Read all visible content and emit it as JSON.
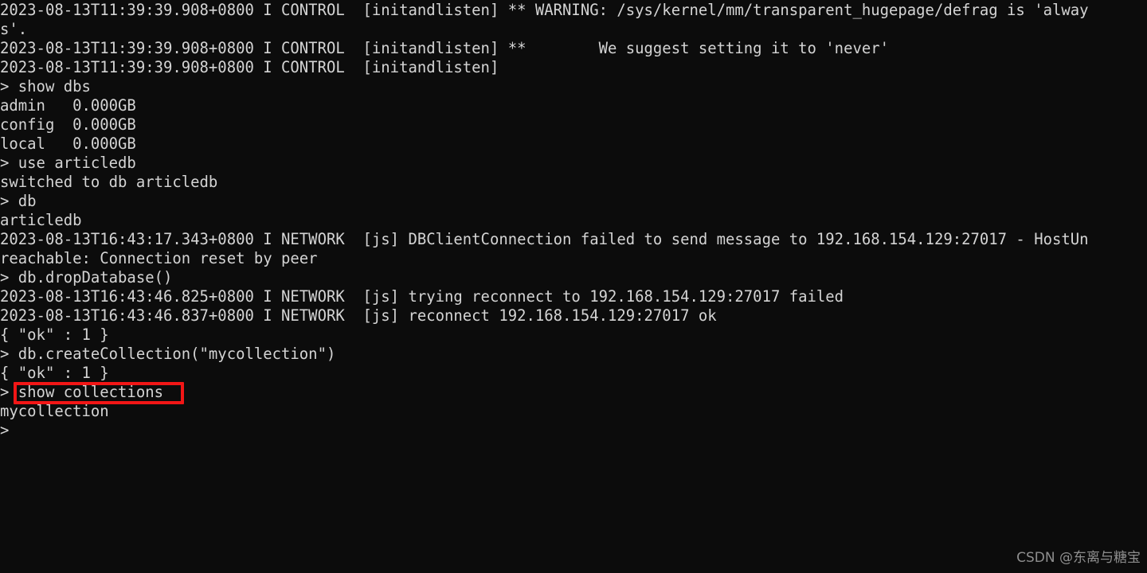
{
  "terminal": {
    "title": "mongo shell",
    "background_color": "#0c0c0c",
    "foreground_color": "#d4d4d4",
    "prompt": ">",
    "lines": [
      "2023-08-13T11:39:39.908+0800 I CONTROL  [initandlisten] ** WARNING: /sys/kernel/mm/transparent_hugepage/defrag is 'alway",
      "s'.",
      "2023-08-13T11:39:39.908+0800 I CONTROL  [initandlisten] **        We suggest setting it to 'never'",
      "2023-08-13T11:39:39.908+0800 I CONTROL  [initandlisten]",
      "> show dbs",
      "admin   0.000GB",
      "config  0.000GB",
      "local   0.000GB",
      "> use articledb",
      "switched to db articledb",
      "> db",
      "articledb",
      "2023-08-13T16:43:17.343+0800 I NETWORK  [js] DBClientConnection failed to send message to 192.168.154.129:27017 - HostUn",
      "reachable: Connection reset by peer",
      "> db.dropDatabase()",
      "2023-08-13T16:43:46.825+0800 I NETWORK  [js] trying reconnect to 192.168.154.129:27017 failed",
      "2023-08-13T16:43:46.837+0800 I NETWORK  [js] reconnect 192.168.154.129:27017 ok",
      "{ \"ok\" : 1 }",
      "> db.createCollection(\"mycollection\")",
      "{ \"ok\" : 1 }",
      "> show collections",
      "mycollection",
      ">"
    ]
  },
  "annotation": {
    "highlight_target": "show collections",
    "color": "#f21616"
  },
  "watermark": {
    "text": "CSDN @东离与糖宝"
  }
}
